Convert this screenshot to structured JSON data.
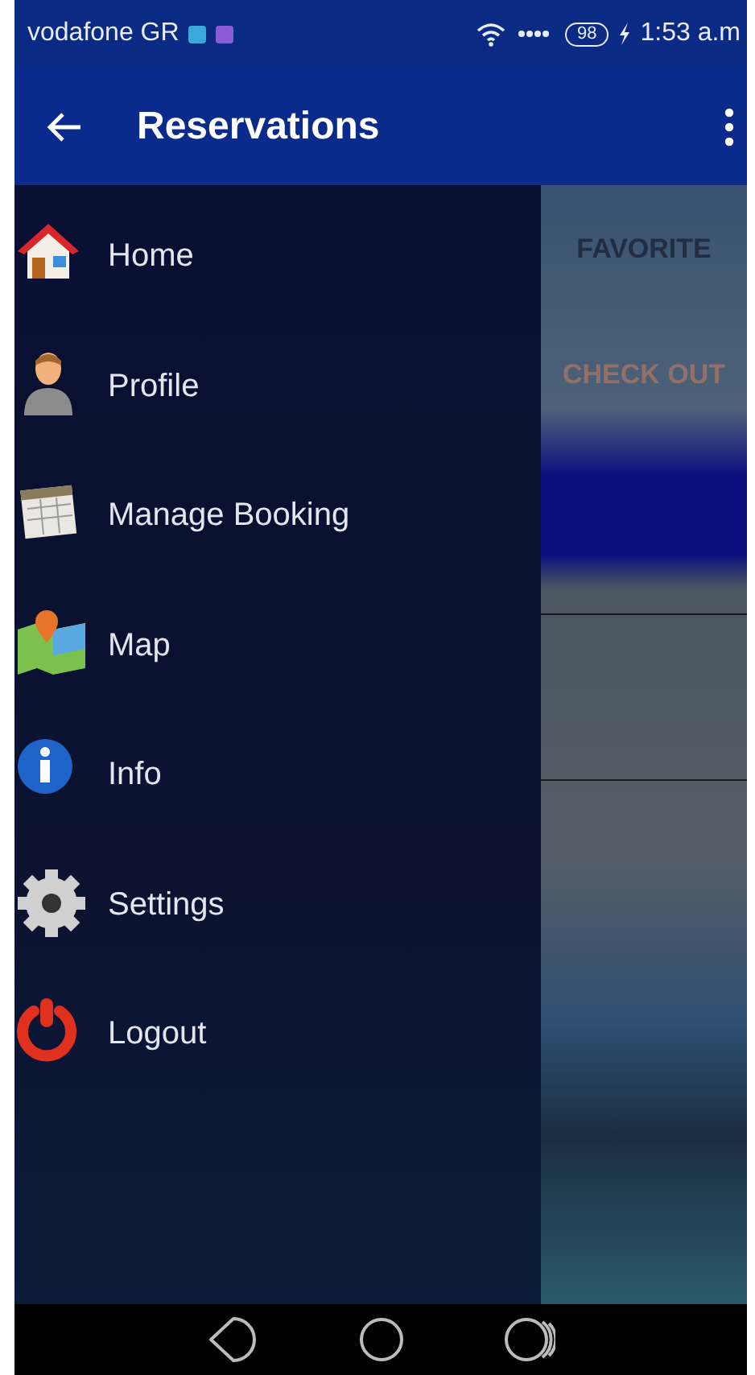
{
  "status_bar": {
    "carrier": "vodafone GR",
    "battery": "98",
    "time": "1:53 a.m"
  },
  "app_bar": {
    "title": "Reservations"
  },
  "background": {
    "tabs": [
      "FAVORITE",
      "CHECK OUT"
    ]
  },
  "drawer": {
    "items": [
      {
        "kind": "home",
        "label": "Home"
      },
      {
        "kind": "profile",
        "label": "Profile"
      },
      {
        "kind": "booking",
        "label": "Manage Booking"
      },
      {
        "kind": "map",
        "label": "Map"
      },
      {
        "kind": "info",
        "label": "Info"
      },
      {
        "kind": "settings",
        "label": "Settings"
      },
      {
        "kind": "logout",
        "label": "Logout"
      }
    ]
  }
}
